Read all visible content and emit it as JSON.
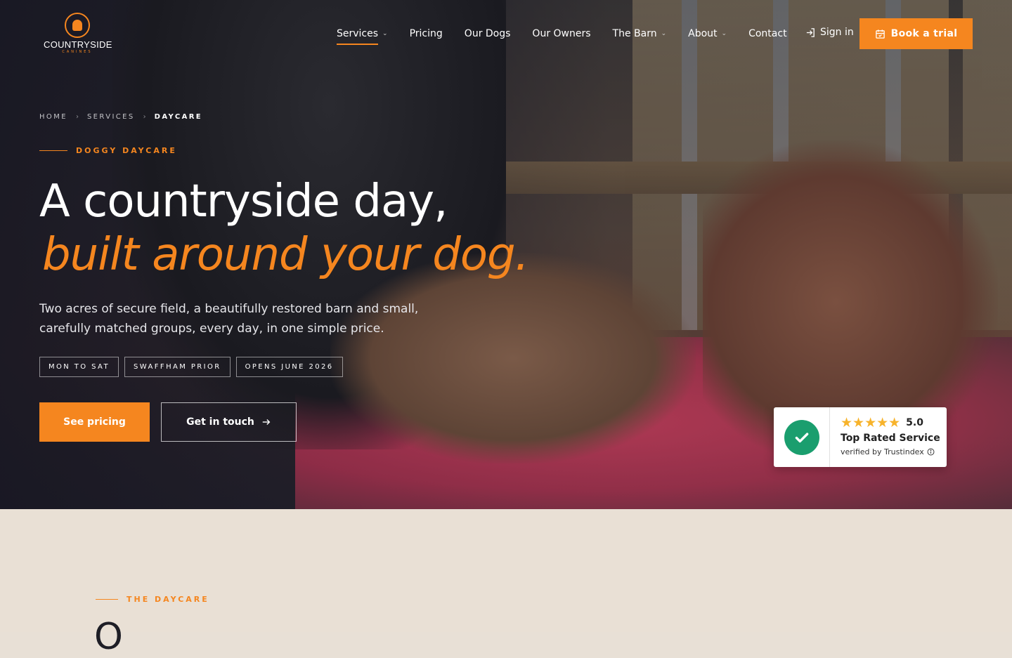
{
  "brand": {
    "name": "COUNTRYSIDE",
    "tagline": "CANINES",
    "accent": "#f5861f"
  },
  "nav": {
    "items": [
      {
        "label": "Services",
        "has_dropdown": true,
        "active": true
      },
      {
        "label": "Pricing",
        "has_dropdown": false
      },
      {
        "label": "Our Dogs",
        "has_dropdown": false
      },
      {
        "label": "Our Owners",
        "has_dropdown": false
      },
      {
        "label": "The Barn",
        "has_dropdown": true
      },
      {
        "label": "About",
        "has_dropdown": true
      },
      {
        "label": "Contact",
        "has_dropdown": false
      }
    ],
    "signin_label": "Sign in",
    "book_label": "Book a trial"
  },
  "breadcrumb": [
    "HOME",
    "SERVICES",
    "DAYCARE"
  ],
  "hero": {
    "eyebrow": "DOGGY DAYCARE",
    "title_line1": "A countryside day,",
    "title_line2": "built around your dog.",
    "lede_line1": "Two acres of secure field, a beautifully restored barn and small,",
    "lede_line2": "carefully matched groups, every day, in one simple price.",
    "tags": [
      "MON TO SAT",
      "SWAFFHAM PRIOR",
      "OPENS JUNE 2026"
    ],
    "primary_cta": "See pricing",
    "secondary_cta": "Get in touch"
  },
  "trust_badge": {
    "stars": "★★★★★",
    "score": "5.0",
    "title": "Top Rated Service",
    "subtitle": "verified by Trustindex",
    "check_color": "#1a9e6e",
    "star_color": "#f7b32b"
  },
  "section": {
    "eyebrow": "THE DAYCARE",
    "title_partial": "O"
  }
}
